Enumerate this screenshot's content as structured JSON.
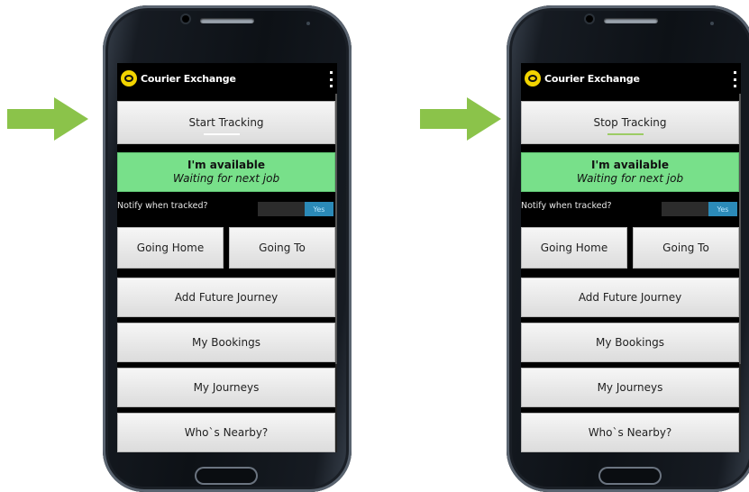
{
  "colors": {
    "arrow": "#8bc34a",
    "status_bg": "#78e08a",
    "toggle_on": "#2b8ab8",
    "tracking_indicator_idle": "#ffffff",
    "tracking_indicator_active": "#9ccc65"
  },
  "phones": [
    {
      "app_title": "Courier Exchange",
      "tracking_button": "Start Tracking",
      "status_title": "I'm available",
      "status_subtitle": "Waiting for next job",
      "notify_label": "Notify when tracked?",
      "toggle_label": "Yes",
      "going_home": "Going Home",
      "going_to": "Going To",
      "add_future_journey": "Add Future Journey",
      "my_bookings": "My Bookings",
      "my_journeys": "My Journeys",
      "whos_nearby": "Who`s Nearby?"
    },
    {
      "app_title": "Courier Exchange",
      "tracking_button": "Stop Tracking",
      "status_title": "I'm available",
      "status_subtitle": "Waiting for next job",
      "notify_label": "Notify when tracked?",
      "toggle_label": "Yes",
      "going_home": "Going Home",
      "going_to": "Going To",
      "add_future_journey": "Add Future Journey",
      "my_bookings": "My Bookings",
      "my_journeys": "My Journeys",
      "whos_nearby": "Who`s Nearby?"
    }
  ]
}
